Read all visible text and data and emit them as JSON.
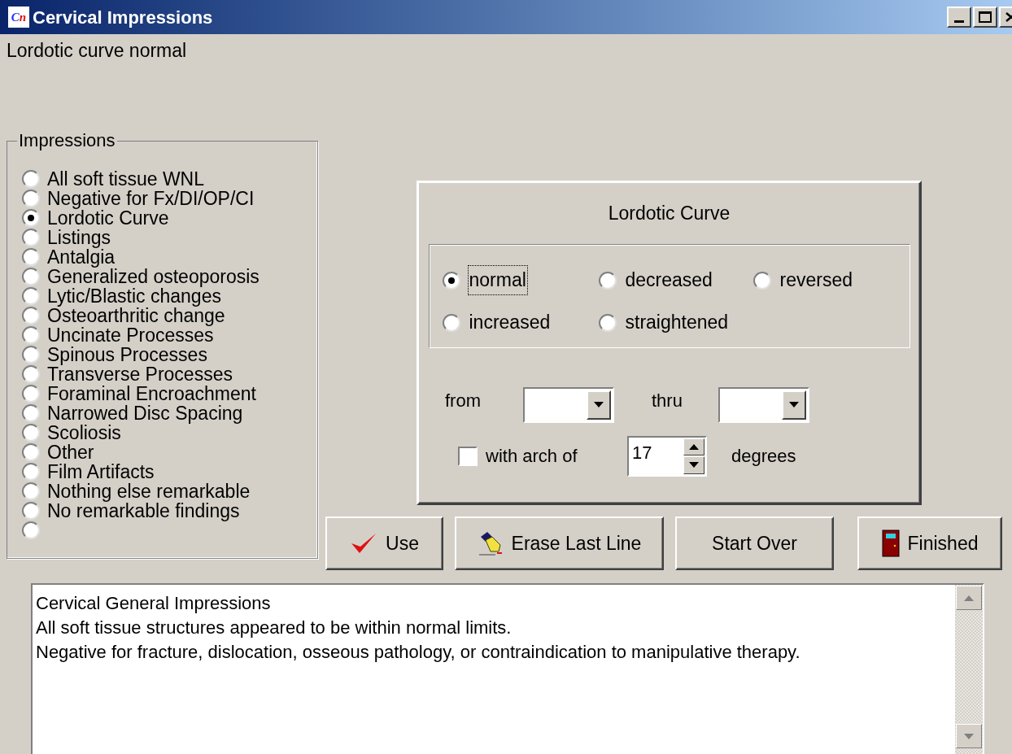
{
  "window": {
    "title": "Cervical Impressions",
    "logo_letters": [
      "C",
      "n"
    ]
  },
  "status_text": "Lordotic curve normal",
  "impressions": {
    "legend": "Impressions",
    "options": [
      {
        "label": "All soft tissue WNL",
        "selected": false
      },
      {
        "label": "Negative for Fx/DI/OP/CI",
        "selected": false
      },
      {
        "label": "Lordotic Curve",
        "selected": true
      },
      {
        "label": "Listings",
        "selected": false
      },
      {
        "label": "Antalgia",
        "selected": false
      },
      {
        "label": "Generalized osteoporosis",
        "selected": false
      },
      {
        "label": "Lytic/Blastic changes",
        "selected": false
      },
      {
        "label": "Osteoarthritic change",
        "selected": false
      },
      {
        "label": "Uncinate Processes",
        "selected": false
      },
      {
        "label": "Spinous Processes",
        "selected": false
      },
      {
        "label": "Transverse Processes",
        "selected": false
      },
      {
        "label": "Foraminal Encroachment",
        "selected": false
      },
      {
        "label": "Narrowed Disc Spacing",
        "selected": false
      },
      {
        "label": "Scoliosis",
        "selected": false
      },
      {
        "label": "Other",
        "selected": false
      },
      {
        "label": "Film Artifacts",
        "selected": false
      },
      {
        "label": "Nothing else remarkable",
        "selected": false
      },
      {
        "label": "No remarkable findings",
        "selected": false
      },
      {
        "selected": false
      }
    ]
  },
  "curve_panel": {
    "title": "Lordotic Curve",
    "options": [
      {
        "label": "normal",
        "selected": true
      },
      {
        "label": "decreased",
        "selected": false
      },
      {
        "label": "reversed",
        "selected": false
      },
      {
        "label": "increased",
        "selected": false
      },
      {
        "label": "straightened",
        "selected": false
      }
    ],
    "from_label": "from",
    "thru_label": "thru",
    "arch": {
      "checked": false,
      "label": "with arch of",
      "value": "17",
      "unit": "degrees"
    }
  },
  "buttons": [
    {
      "label": "Use",
      "kind": "check"
    },
    {
      "label": "Erase Last Line",
      "kind": "eraser"
    },
    {
      "label": "Start Over",
      "kind": "plain"
    },
    {
      "label": "Finished",
      "kind": "door"
    }
  ],
  "report_lines": [
    "Cervical General Impressions",
    "All soft tissue structures appeared to be within normal limits.",
    "Negative for fracture, dislocation, osseous pathology, or contraindication to manipulative therapy."
  ]
}
